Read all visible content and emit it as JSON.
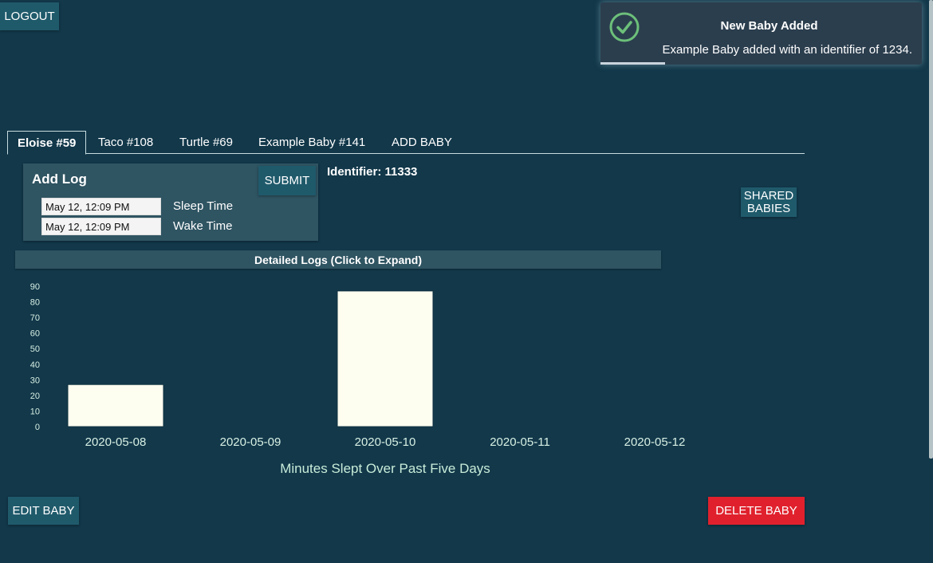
{
  "header": {
    "logout_label": "LOGOUT"
  },
  "toast": {
    "title": "New Baby Added",
    "message": "Example Baby added with an identifier of 1234.",
    "icon": "check-circle-icon",
    "progress": 0.2,
    "accent_color": "#6cc07a"
  },
  "tabs": [
    {
      "label": "Eloise #59",
      "active": true
    },
    {
      "label": "Taco #108"
    },
    {
      "label": "Turtle #69"
    },
    {
      "label": "Example Baby #141"
    },
    {
      "label": "ADD BABY"
    }
  ],
  "add_log": {
    "title": "Add Log",
    "submit_label": "SUBMIT",
    "sleep_value": "May 12, 12:09 PM",
    "sleep_label": "Sleep Time",
    "wake_value": "May 12, 12:09 PM",
    "wake_label": "Wake Time"
  },
  "identifier": "Identifier: 11333",
  "shared_babies_label": "SHARED BABIES",
  "detailed_logs_label": "Detailed Logs (Click to Expand)",
  "chart_data": {
    "type": "bar",
    "title": "Minutes Slept Over Past Five Days",
    "categories": [
      "2020-05-08",
      "2020-05-09",
      "2020-05-10",
      "2020-05-11",
      "2020-05-12"
    ],
    "values": [
      27,
      0,
      87,
      0,
      0
    ],
    "ylim": [
      0,
      90
    ],
    "yticks": [
      0,
      10,
      20,
      30,
      40,
      50,
      60,
      70,
      80,
      90
    ],
    "bar_color": "#fdfdf0",
    "grid": false
  },
  "footer": {
    "edit_label": "EDIT BABY",
    "delete_label": "DELETE BABY"
  },
  "colors": {
    "background": "#12384a",
    "button": "#1f5a6b",
    "danger": "#e0212d"
  }
}
